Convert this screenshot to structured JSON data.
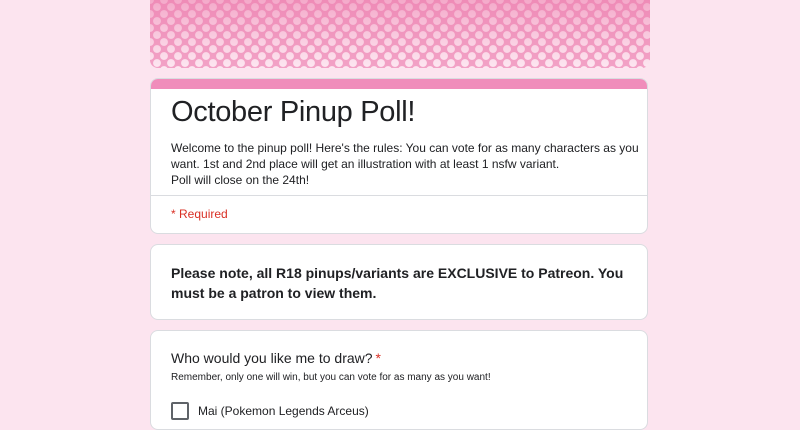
{
  "form": {
    "title": "October Pinup Poll!",
    "description_lines": [
      "Welcome to the pinup poll! Here's the rules: You can vote for as many characters as you",
      "want. 1st and 2nd place will get an illustration with at least 1 nsfw variant.",
      "Poll will close on the 24th!"
    ],
    "required_note": "* Required"
  },
  "notice": {
    "text": "Please note, all R18 pinups/variants are EXCLUSIVE to Patreon. You must be a patron to view them."
  },
  "question": {
    "title": "Who would you like me to draw?",
    "required_marker": "*",
    "help": "Remember, only one will win, but you can vote for as many as you want!",
    "options": [
      {
        "label": "Mai (Pokemon Legends Arceus)",
        "checked": false
      }
    ]
  },
  "colors": {
    "page_background": "#fce4ef",
    "accent": "#f08dbb",
    "banner_pink": "#f2a2c6",
    "required_red": "#d93025"
  }
}
